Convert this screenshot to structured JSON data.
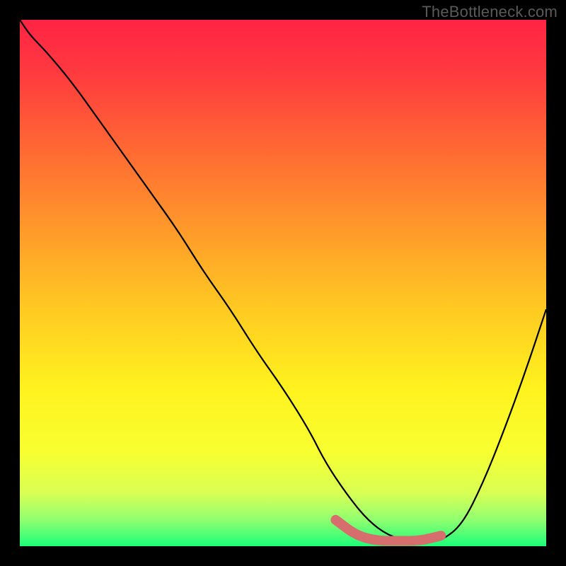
{
  "watermark": "TheBottleneck.com",
  "chart_data": {
    "type": "line",
    "title": "",
    "xlabel": "",
    "ylabel": "",
    "xlim": [
      0,
      100
    ],
    "ylim": [
      0,
      100
    ],
    "grid": false,
    "series": [
      {
        "name": "curve",
        "x": [
          0,
          2,
          5,
          10,
          15,
          20,
          25,
          30,
          35,
          40,
          45,
          50,
          55,
          58,
          62,
          66,
          70,
          74,
          78,
          80,
          84,
          88,
          92,
          96,
          100
        ],
        "y": [
          100,
          97,
          94,
          88,
          81,
          74,
          67,
          60,
          52,
          45,
          37,
          30,
          22,
          16,
          10,
          5,
          2,
          1,
          1,
          1,
          4,
          12,
          22,
          33,
          45
        ]
      },
      {
        "name": "sweet-spot",
        "x": [
          60,
          64,
          68,
          72,
          76,
          80
        ],
        "y": [
          5,
          2,
          1,
          1,
          1,
          2
        ]
      }
    ],
    "gradient_stops": [
      {
        "offset": 0.0,
        "color": "#ff2445"
      },
      {
        "offset": 0.1,
        "color": "#ff3a3f"
      },
      {
        "offset": 0.25,
        "color": "#ff6a33"
      },
      {
        "offset": 0.4,
        "color": "#ff9a2a"
      },
      {
        "offset": 0.55,
        "color": "#ffca22"
      },
      {
        "offset": 0.7,
        "color": "#fff21e"
      },
      {
        "offset": 0.82,
        "color": "#f8ff30"
      },
      {
        "offset": 0.9,
        "color": "#d8ff55"
      },
      {
        "offset": 0.95,
        "color": "#90ff70"
      },
      {
        "offset": 1.0,
        "color": "#1cff7a"
      }
    ],
    "sweet_spot_color": "#d66e6e",
    "curve_color": "#000000"
  }
}
